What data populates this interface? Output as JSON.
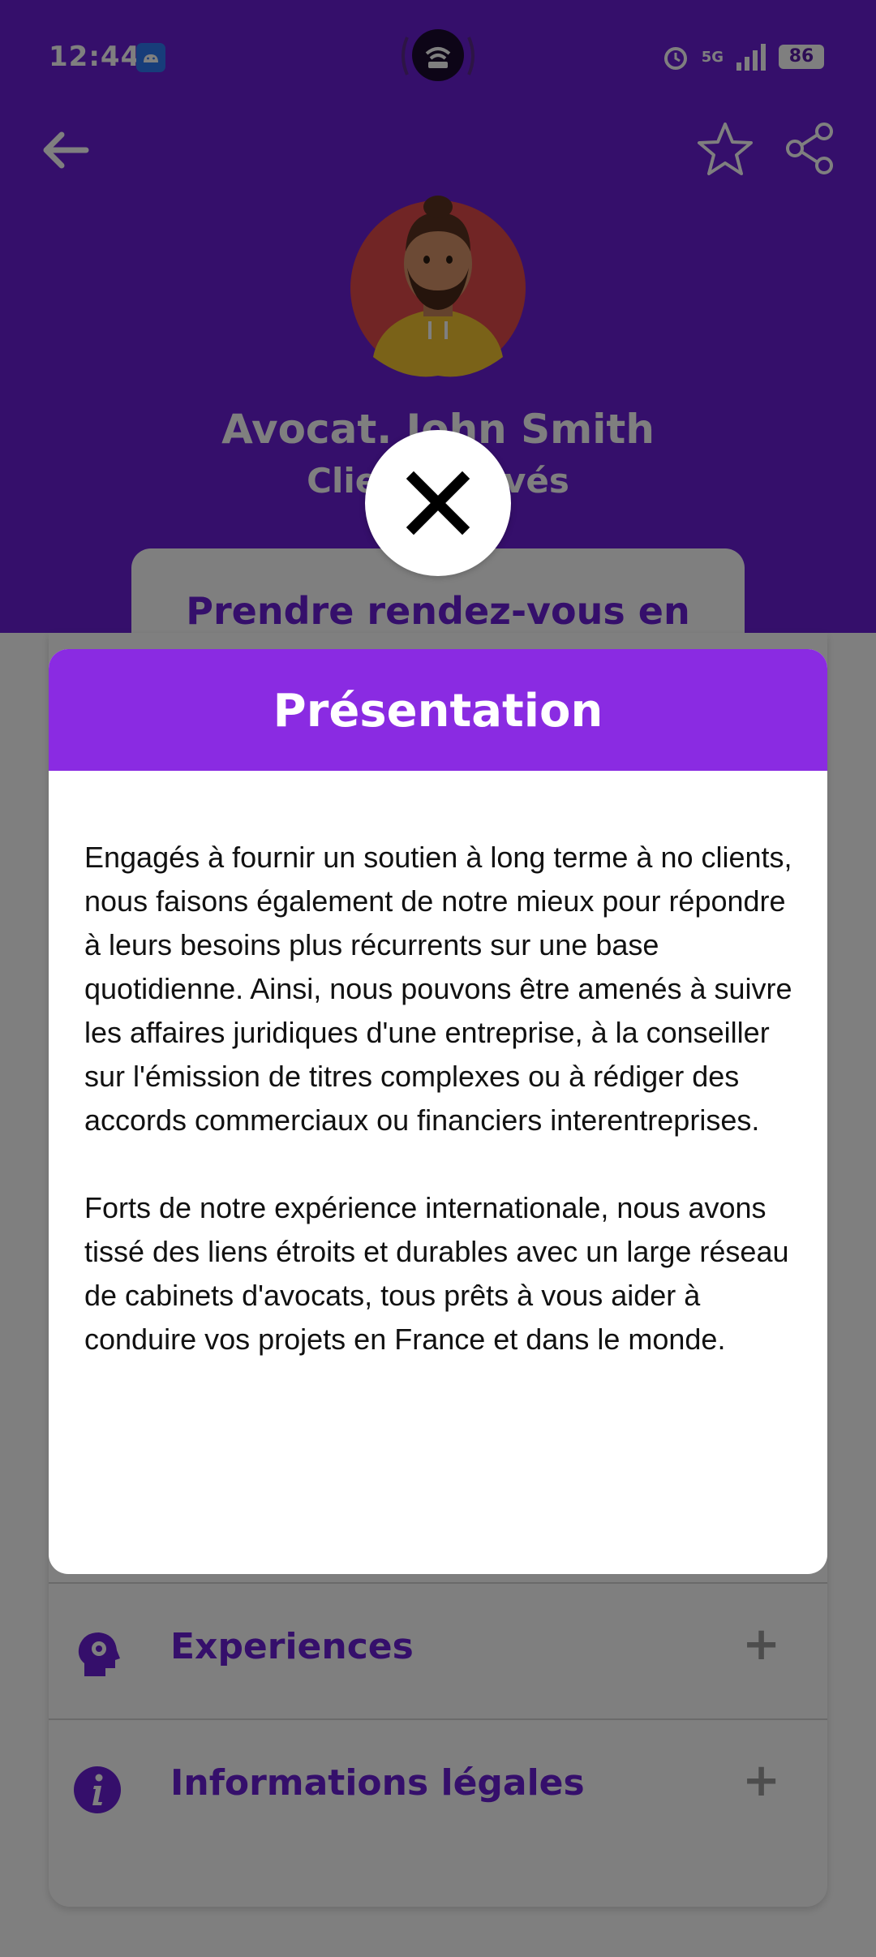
{
  "status_bar": {
    "time": "12:44",
    "network": "5G",
    "battery": "86"
  },
  "toolbar": {
    "back_icon": "arrow-left-icon",
    "favorite_icon": "star-outline-icon",
    "share_icon": "share-icon"
  },
  "profile": {
    "name": "Avocat. John Smith",
    "subtitle": "Clients privés",
    "booking_button": "Prendre rendez-vous en ligne"
  },
  "sections": [
    {
      "label": "Experiences",
      "icon": "head-gears-icon"
    },
    {
      "label": "Informations légales",
      "icon": "info-icon"
    }
  ],
  "modal": {
    "title": "Présentation",
    "paragraphs": [
      "Engagés à fournir un soutien à long terme à no clients, nous faisons également de notre mieux pour répondre à leurs besoins plus récurrents sur une base quotidienne. Ainsi, nous pouvons être amenés à suivre les affaires juridiques d'une entreprise, à la conseiller sur l'émission de titres complexes ou à rédiger des accords commerciaux ou financiers interentreprises.",
      "Forts de notre expérience internationale, nous avons tissé des liens étroits et durables avec un large réseau de cabinets d'avocats, tous prêts à vous aider à conduire vos projets en France et dans le monde."
    ],
    "close_icon": "close-icon"
  },
  "colors": {
    "header_purple": "#6a1fd6",
    "modal_header_purple": "#8a2be2"
  }
}
